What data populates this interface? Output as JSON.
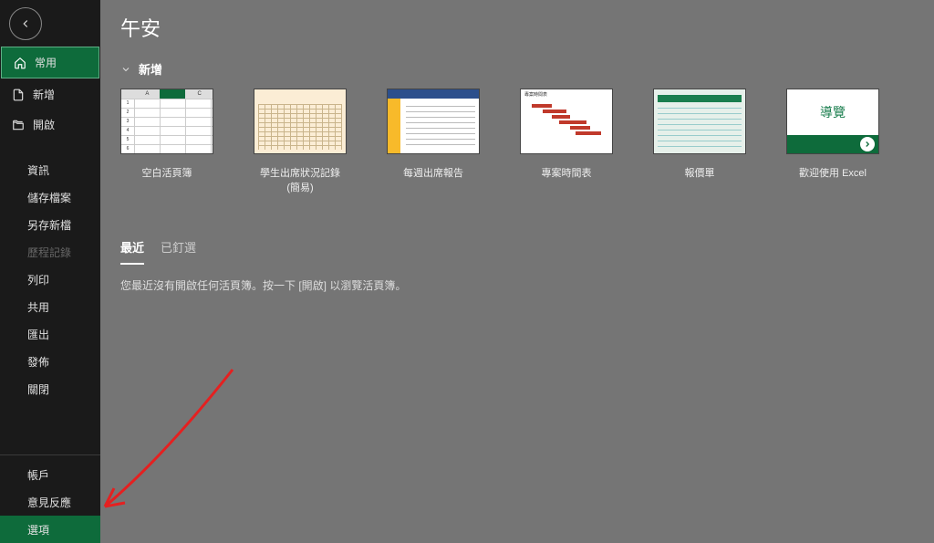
{
  "greeting": "午安",
  "section": {
    "new_label": "新增"
  },
  "sidebar": {
    "top": [
      {
        "icon": "home-icon",
        "label": "常用",
        "selected": true
      },
      {
        "icon": "file-icon",
        "label": "新增"
      },
      {
        "icon": "folder-open-icon",
        "label": "開啟"
      }
    ],
    "mid": [
      {
        "label": "資訊"
      },
      {
        "label": "儲存檔案"
      },
      {
        "label": "另存新檔"
      },
      {
        "label": "歷程記錄",
        "disabled": true
      },
      {
        "label": "列印"
      },
      {
        "label": "共用"
      },
      {
        "label": "匯出"
      },
      {
        "label": "發佈"
      },
      {
        "label": "關閉"
      }
    ],
    "bottom": [
      {
        "label": "帳戶"
      },
      {
        "label": "意見反應"
      },
      {
        "label": "選項",
        "selected": true
      }
    ]
  },
  "templates": [
    {
      "label": "空白活頁簿",
      "kind": "blank"
    },
    {
      "label": "學生出席狀況記錄 (簡易)",
      "kind": "attendance"
    },
    {
      "label": "每週出席報告",
      "kind": "weekly"
    },
    {
      "label": "專案時間表",
      "kind": "gantt",
      "thumb_title": "專案時間表"
    },
    {
      "label": "報價單",
      "kind": "quote"
    },
    {
      "label": "歡迎使用 Excel",
      "kind": "tour",
      "tour_text": "導覽"
    }
  ],
  "docs": {
    "tabs": {
      "recent": "最近",
      "pinned": "已釘選"
    },
    "empty": "您最近沒有開啟任何活頁簿。按一下 [開啟] 以瀏覽活頁簿。"
  },
  "colors": {
    "accent": "#0e6b3b",
    "bg": "#757575",
    "sidebar": "#1a1a1a"
  }
}
